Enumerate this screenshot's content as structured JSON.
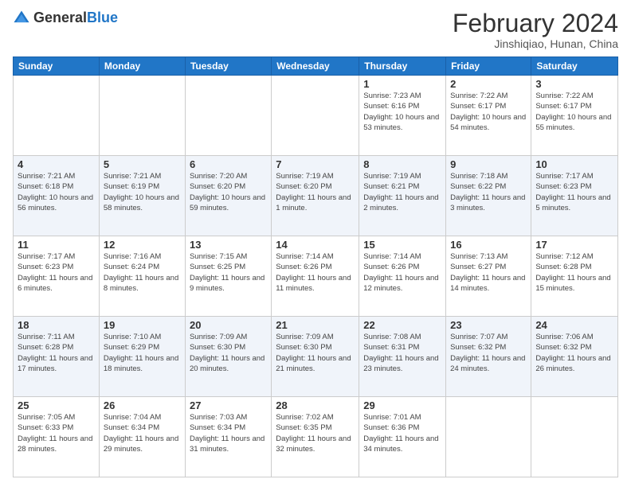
{
  "header": {
    "logo": {
      "general": "General",
      "blue": "Blue"
    },
    "title": "February 2024",
    "location": "Jinshiqiao, Hunan, China"
  },
  "days_of_week": [
    "Sunday",
    "Monday",
    "Tuesday",
    "Wednesday",
    "Thursday",
    "Friday",
    "Saturday"
  ],
  "weeks": [
    [
      {
        "day": "",
        "info": ""
      },
      {
        "day": "",
        "info": ""
      },
      {
        "day": "",
        "info": ""
      },
      {
        "day": "",
        "info": ""
      },
      {
        "day": "1",
        "info": "Sunrise: 7:23 AM\nSunset: 6:16 PM\nDaylight: 10 hours\nand 53 minutes."
      },
      {
        "day": "2",
        "info": "Sunrise: 7:22 AM\nSunset: 6:17 PM\nDaylight: 10 hours\nand 54 minutes."
      },
      {
        "day": "3",
        "info": "Sunrise: 7:22 AM\nSunset: 6:17 PM\nDaylight: 10 hours\nand 55 minutes."
      }
    ],
    [
      {
        "day": "4",
        "info": "Sunrise: 7:21 AM\nSunset: 6:18 PM\nDaylight: 10 hours\nand 56 minutes."
      },
      {
        "day": "5",
        "info": "Sunrise: 7:21 AM\nSunset: 6:19 PM\nDaylight: 10 hours\nand 58 minutes."
      },
      {
        "day": "6",
        "info": "Sunrise: 7:20 AM\nSunset: 6:20 PM\nDaylight: 10 hours\nand 59 minutes."
      },
      {
        "day": "7",
        "info": "Sunrise: 7:19 AM\nSunset: 6:20 PM\nDaylight: 11 hours\nand 1 minute."
      },
      {
        "day": "8",
        "info": "Sunrise: 7:19 AM\nSunset: 6:21 PM\nDaylight: 11 hours\nand 2 minutes."
      },
      {
        "day": "9",
        "info": "Sunrise: 7:18 AM\nSunset: 6:22 PM\nDaylight: 11 hours\nand 3 minutes."
      },
      {
        "day": "10",
        "info": "Sunrise: 7:17 AM\nSunset: 6:23 PM\nDaylight: 11 hours\nand 5 minutes."
      }
    ],
    [
      {
        "day": "11",
        "info": "Sunrise: 7:17 AM\nSunset: 6:23 PM\nDaylight: 11 hours\nand 6 minutes."
      },
      {
        "day": "12",
        "info": "Sunrise: 7:16 AM\nSunset: 6:24 PM\nDaylight: 11 hours\nand 8 minutes."
      },
      {
        "day": "13",
        "info": "Sunrise: 7:15 AM\nSunset: 6:25 PM\nDaylight: 11 hours\nand 9 minutes."
      },
      {
        "day": "14",
        "info": "Sunrise: 7:14 AM\nSunset: 6:26 PM\nDaylight: 11 hours\nand 11 minutes."
      },
      {
        "day": "15",
        "info": "Sunrise: 7:14 AM\nSunset: 6:26 PM\nDaylight: 11 hours\nand 12 minutes."
      },
      {
        "day": "16",
        "info": "Sunrise: 7:13 AM\nSunset: 6:27 PM\nDaylight: 11 hours\nand 14 minutes."
      },
      {
        "day": "17",
        "info": "Sunrise: 7:12 AM\nSunset: 6:28 PM\nDaylight: 11 hours\nand 15 minutes."
      }
    ],
    [
      {
        "day": "18",
        "info": "Sunrise: 7:11 AM\nSunset: 6:28 PM\nDaylight: 11 hours\nand 17 minutes."
      },
      {
        "day": "19",
        "info": "Sunrise: 7:10 AM\nSunset: 6:29 PM\nDaylight: 11 hours\nand 18 minutes."
      },
      {
        "day": "20",
        "info": "Sunrise: 7:09 AM\nSunset: 6:30 PM\nDaylight: 11 hours\nand 20 minutes."
      },
      {
        "day": "21",
        "info": "Sunrise: 7:09 AM\nSunset: 6:30 PM\nDaylight: 11 hours\nand 21 minutes."
      },
      {
        "day": "22",
        "info": "Sunrise: 7:08 AM\nSunset: 6:31 PM\nDaylight: 11 hours\nand 23 minutes."
      },
      {
        "day": "23",
        "info": "Sunrise: 7:07 AM\nSunset: 6:32 PM\nDaylight: 11 hours\nand 24 minutes."
      },
      {
        "day": "24",
        "info": "Sunrise: 7:06 AM\nSunset: 6:32 PM\nDaylight: 11 hours\nand 26 minutes."
      }
    ],
    [
      {
        "day": "25",
        "info": "Sunrise: 7:05 AM\nSunset: 6:33 PM\nDaylight: 11 hours\nand 28 minutes."
      },
      {
        "day": "26",
        "info": "Sunrise: 7:04 AM\nSunset: 6:34 PM\nDaylight: 11 hours\nand 29 minutes."
      },
      {
        "day": "27",
        "info": "Sunrise: 7:03 AM\nSunset: 6:34 PM\nDaylight: 11 hours\nand 31 minutes."
      },
      {
        "day": "28",
        "info": "Sunrise: 7:02 AM\nSunset: 6:35 PM\nDaylight: 11 hours\nand 32 minutes."
      },
      {
        "day": "29",
        "info": "Sunrise: 7:01 AM\nSunset: 6:36 PM\nDaylight: 11 hours\nand 34 minutes."
      },
      {
        "day": "",
        "info": ""
      },
      {
        "day": "",
        "info": ""
      }
    ]
  ]
}
